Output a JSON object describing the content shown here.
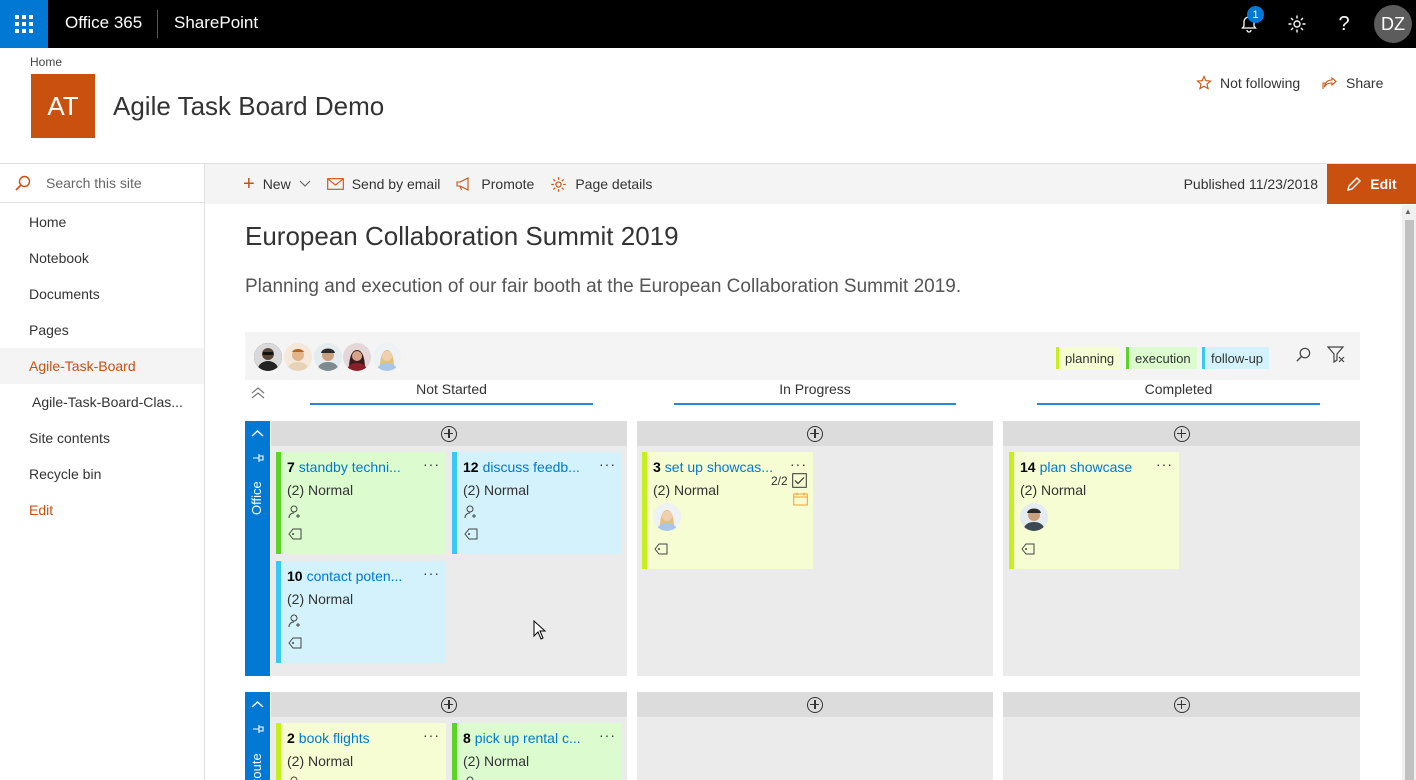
{
  "suite": {
    "brand": "Office 365",
    "app": "SharePoint",
    "notif_count": "1",
    "settings_icon": "gear-icon",
    "help_icon": "question-icon",
    "user_initials": "DZ"
  },
  "site": {
    "breadcrumb": "Home",
    "logo_initials": "AT",
    "title": "Agile Task Board Demo",
    "follow_label": "Not following",
    "share_label": "Share",
    "accent_color": "#ca5010"
  },
  "leftnav": {
    "search_placeholder": "Search this site",
    "items": [
      {
        "label": "Home"
      },
      {
        "label": "Notebook"
      },
      {
        "label": "Documents"
      },
      {
        "label": "Pages"
      },
      {
        "label": "Agile-Task-Board",
        "selected": true
      },
      {
        "label": "Agile-Task-Board-Clas..."
      },
      {
        "label": "Site contents"
      },
      {
        "label": "Recycle bin"
      },
      {
        "label": "Edit"
      }
    ]
  },
  "commandbar": {
    "new_label": "New",
    "send_label": "Send by email",
    "promote_label": "Promote",
    "details_label": "Page details",
    "published": "Published 11/23/2018",
    "edit_label": "Edit"
  },
  "page": {
    "heading": "European Collaboration Summit 2019",
    "description": "Planning and execution of our fair booth at the European Collaboration Summit 2019."
  },
  "board": {
    "tags": [
      {
        "label": "planning",
        "bg": "#f7fdd2",
        "border": "#c6f01c"
      },
      {
        "label": "execution",
        "bg": "#dcfcd0",
        "border": "#5bd427"
      },
      {
        "label": "follow-up",
        "bg": "#d3f2fb",
        "border": "#38c7f6"
      }
    ],
    "columns": [
      "Not Started",
      "In Progress",
      "Completed"
    ],
    "lanes": [
      "Office",
      "Route"
    ],
    "cards": {
      "c7": {
        "id": "7",
        "title": "standby techni...",
        "priority": "(2) Normal"
      },
      "c12": {
        "id": "12",
        "title": "discuss feedb...",
        "priority": "(2) Normal"
      },
      "c10": {
        "id": "10",
        "title": "contact poten...",
        "priority": "(2) Normal"
      },
      "c3": {
        "id": "3",
        "title": "set up showcas...",
        "priority": "(2) Normal",
        "checklist": "2/2"
      },
      "c14": {
        "id": "14",
        "title": "plan showcase",
        "priority": "(2) Normal"
      },
      "c2": {
        "id": "2",
        "title": "book flights",
        "priority": "(2) Normal"
      },
      "c8": {
        "id": "8",
        "title": "pick up rental c...",
        "priority": "(2) Normal"
      }
    }
  }
}
